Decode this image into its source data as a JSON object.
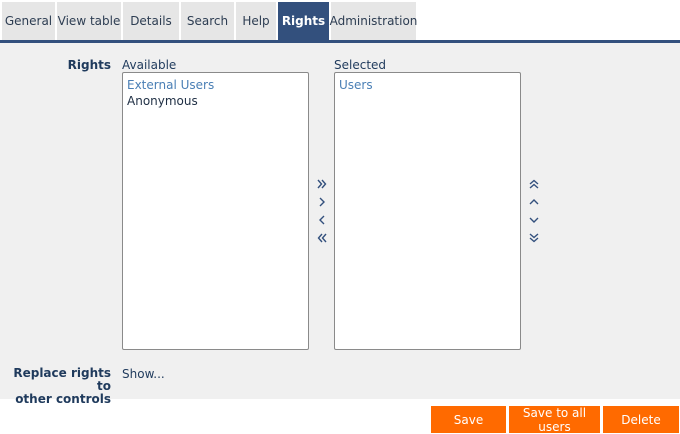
{
  "tabs": [
    {
      "label": "General"
    },
    {
      "label": "View table"
    },
    {
      "label": "Details"
    },
    {
      "label": "Search"
    },
    {
      "label": "Help"
    },
    {
      "label": "Rights",
      "active": true
    },
    {
      "label": "Administration"
    }
  ],
  "rights": {
    "label": "Rights",
    "available_label": "Available",
    "selected_label": "Selected",
    "available_options": [
      {
        "text": "External Users",
        "kind": "group"
      },
      {
        "text": "Anonymous",
        "kind": "item"
      }
    ],
    "selected_options": [
      {
        "text": "Users",
        "kind": "group"
      }
    ]
  },
  "transfer_icons": [
    "move-all-right-icon",
    "move-right-icon",
    "move-left-icon",
    "move-all-left-icon"
  ],
  "order_icons": [
    "move-top-icon",
    "move-up-icon",
    "move-down-icon",
    "move-bottom-icon"
  ],
  "replace": {
    "label_line1": "Replace rights to",
    "label_line2": "other controls",
    "show_link": "Show..."
  },
  "buttons": {
    "save": "Save",
    "save_all": "Save to all users",
    "delete": "Delete"
  },
  "colors": {
    "accent": "#33507d",
    "button": "#ff6a00",
    "panel": "#f0f0f0",
    "group_text": "#4a7fb5"
  }
}
